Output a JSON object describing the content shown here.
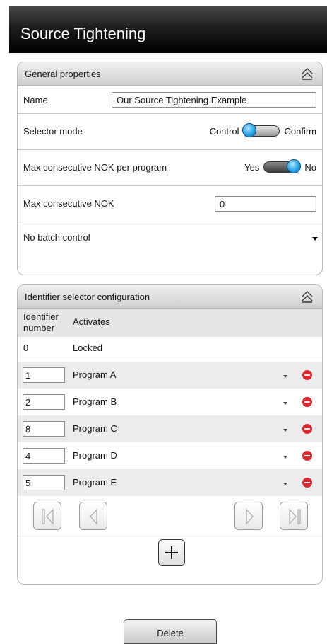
{
  "header": {
    "title": "Source Tightening"
  },
  "general": {
    "title": "General properties",
    "name_label": "Name",
    "name_value": "Our Source Tightening Example",
    "selector_label": "Selector mode",
    "selector_left": "Control",
    "selector_right": "Confirm",
    "selector_state": "Control",
    "maxprog_label": "Max consecutive NOK per program",
    "maxprog_left": "Yes",
    "maxprog_right": "No",
    "maxprog_state": "No",
    "maxnok_label": "Max consecutive NOK",
    "maxnok_value": "0",
    "batch_label": "No batch control"
  },
  "identifier": {
    "title": "Identifier selector configuration",
    "col_number": "Identifier number",
    "col_activates": "Activates",
    "locked_row": {
      "number": "0",
      "activates": "Locked"
    },
    "rows": [
      {
        "number": "1",
        "activates": "Program A"
      },
      {
        "number": "2",
        "activates": "Program B"
      },
      {
        "number": "8",
        "activates": "Program C"
      },
      {
        "number": "4",
        "activates": "Program D"
      },
      {
        "number": "5",
        "activates": "Program E"
      }
    ]
  },
  "footer": {
    "delete_label": "Delete"
  },
  "icons": {
    "collapse": "collapse-up-icon",
    "delete_row": "remove-icon",
    "first": "first-page-icon",
    "prev": "previous-page-icon",
    "next": "next-page-icon",
    "last": "last-page-icon",
    "add": "plus-icon",
    "dropdown": "chevron-down-icon"
  },
  "colors": {
    "accent": "#2aa3e6",
    "remove": "#e0262b",
    "titlebar": "#000000"
  }
}
